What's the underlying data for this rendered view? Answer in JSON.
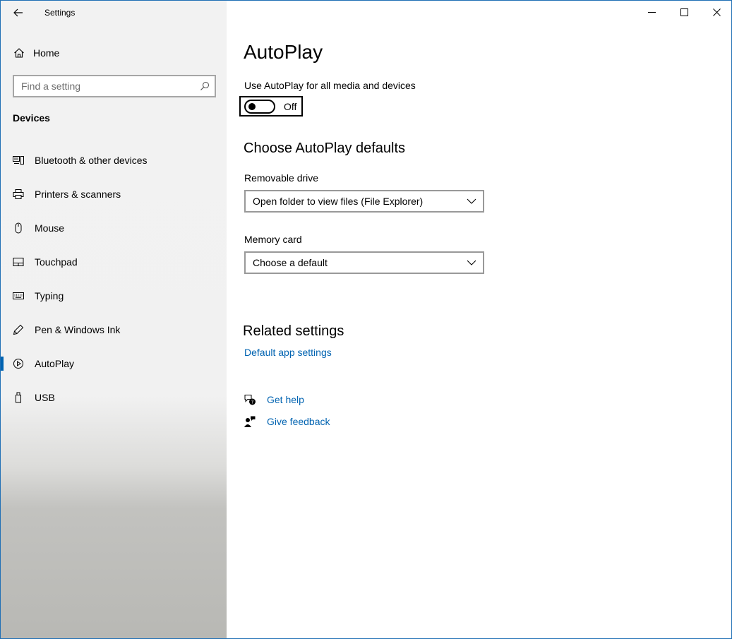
{
  "window": {
    "title": "Settings"
  },
  "sidebar": {
    "home_label": "Home",
    "search_placeholder": "Find a setting",
    "section": "Devices",
    "items": [
      {
        "label": "Bluetooth & other devices",
        "icon": "bluetooth-devices-icon"
      },
      {
        "label": "Printers & scanners",
        "icon": "printer-icon"
      },
      {
        "label": "Mouse",
        "icon": "mouse-icon"
      },
      {
        "label": "Touchpad",
        "icon": "touchpad-icon"
      },
      {
        "label": "Typing",
        "icon": "keyboard-icon"
      },
      {
        "label": "Pen & Windows Ink",
        "icon": "pen-icon"
      },
      {
        "label": "AutoPlay",
        "icon": "autoplay-icon",
        "active": true
      },
      {
        "label": "USB",
        "icon": "usb-icon"
      }
    ]
  },
  "main": {
    "title": "AutoPlay",
    "toggle_label": "Use AutoPlay for all media and devices",
    "toggle_state": "Off",
    "defaults_heading": "Choose AutoPlay defaults",
    "removable_label": "Removable drive",
    "removable_value": "Open folder to view files (File Explorer)",
    "memory_label": "Memory card",
    "memory_value": "Choose a default",
    "related_heading": "Related settings",
    "related_link": "Default app settings",
    "get_help": "Get help",
    "give_feedback": "Give feedback"
  },
  "colors": {
    "accent": "#0063b1",
    "link": "#0063b1"
  }
}
